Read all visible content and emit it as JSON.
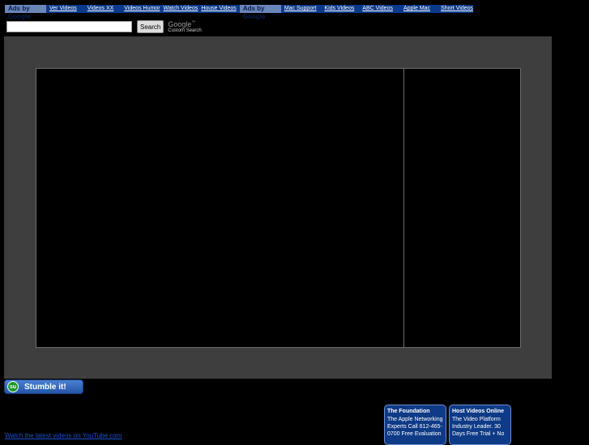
{
  "top_ads": {
    "label": "Ads by Google",
    "links_left": [
      "Ver Videos",
      "Videos XX",
      "Videos Humor",
      "Watch Videos",
      "House Videos"
    ],
    "label2": "Ads by Google",
    "links_right": [
      "Mac Support",
      "Kids Videos",
      "ABC Videos",
      "Apple Mac",
      "Short Videos"
    ]
  },
  "search": {
    "input_value": "",
    "button_label": "Search",
    "brand": "Google",
    "brand_tm": "™",
    "brand_sub": "Custom Search"
  },
  "stumble": {
    "icon_text": "su",
    "label": "Stumble it!"
  },
  "footer": {
    "youtube_link": "Watch the latest videos on YouTube.com"
  },
  "side_ads": [
    {
      "title": "The Foundation",
      "body": "The Apple Networking Experts Call 612-465-0700 Free Evaluation"
    },
    {
      "title": "Host Videos Online",
      "body": "The Video Platform Industry Leader. 30 Days Free Trial + No"
    }
  ],
  "colors": {
    "ad_bar": "#0b3a8c",
    "frame": "#3e3e3e",
    "link": "#1e4fd1"
  }
}
